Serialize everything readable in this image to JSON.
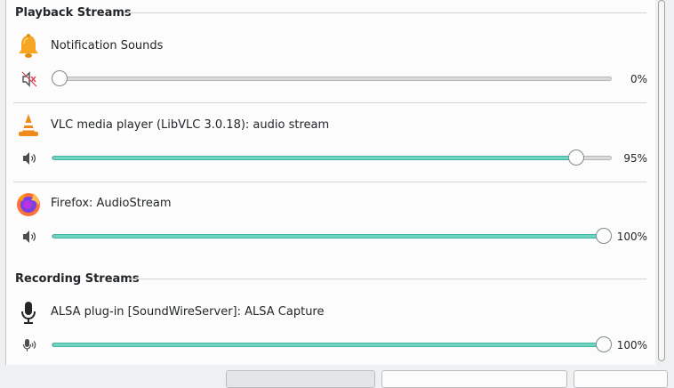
{
  "sections": {
    "playback_title": "Playback Streams",
    "recording_title": "Recording Streams"
  },
  "streams": [
    {
      "name": "Notification Sounds",
      "icon": "bell-icon",
      "volume_icon": "speaker-muted-icon",
      "percent": "0%",
      "level": 0.0
    },
    {
      "name": "VLC media player (LibVLC 3.0.18): audio stream",
      "icon": "vlc-cone-icon",
      "volume_icon": "speaker-icon",
      "percent": "95%",
      "level": 0.95
    },
    {
      "name": "Firefox: AudioStream",
      "icon": "firefox-icon",
      "volume_icon": "speaker-icon",
      "percent": "100%",
      "level": 1.0
    },
    {
      "name": "ALSA plug-in [SoundWireServer]: ALSA Capture",
      "icon": "microphone-icon",
      "volume_icon": "microphone-small-icon",
      "percent": "100%",
      "level": 1.0
    }
  ],
  "colors": {
    "slider_fill": "#6fd5c3",
    "bell": "#f5a623",
    "vlc_orange": "#f08a1c",
    "firefox_orange": "#ff7139",
    "firefox_purple": "#7542e5"
  }
}
